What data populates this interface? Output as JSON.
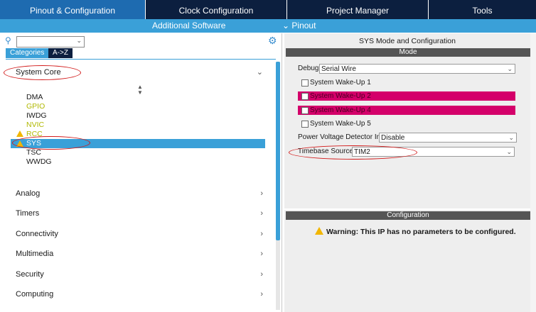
{
  "tabs": [
    {
      "label": "Pinout & Configuration"
    },
    {
      "label": "Clock Configuration"
    },
    {
      "label": "Project Manager"
    },
    {
      "label": "Tools"
    }
  ],
  "subbar": {
    "additional_software": "Additional Software",
    "pinout": "Pinout"
  },
  "left": {
    "search_value": "",
    "view_tabs": {
      "categories": "Categories",
      "az": "A->Z"
    },
    "system_core": "System Core",
    "items": [
      "DMA",
      "GPIO",
      "IWDG",
      "NVIC",
      "RCC",
      "SYS",
      "TSC",
      "WWDG"
    ],
    "sections": [
      "Analog",
      "Timers",
      "Connectivity",
      "Multimedia",
      "Security",
      "Computing"
    ]
  },
  "right": {
    "title": "SYS Mode and Configuration",
    "mode_header": "Mode",
    "debug_label": "Debug",
    "debug_value": "Serial Wire",
    "wakeups": [
      "System Wake-Up 1",
      "System Wake-Up 2",
      "System Wake-Up 4",
      "System Wake-Up 5"
    ],
    "pvd_label": "Power Voltage Detector In",
    "pvd_value": "Disable",
    "timebase_label": "Timebase Source",
    "timebase_value": "TIM2",
    "config_header": "Configuration",
    "warning": "Warning: This IP has no parameters to be configured."
  },
  "colors": {
    "accent": "#3aa0d8",
    "dark": "#0c1f3f",
    "highlight": "#d4006a",
    "annotation": "#d21a1a"
  }
}
